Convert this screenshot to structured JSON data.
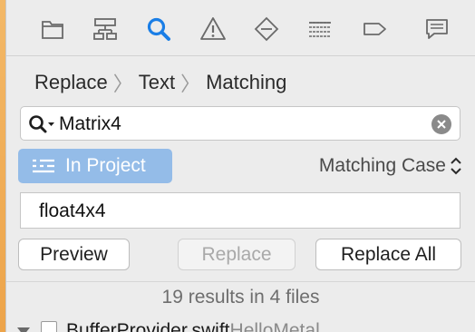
{
  "navigator": {
    "tabs": [
      {
        "name": "project-navigator",
        "icon": "folder-icon"
      },
      {
        "name": "symbol-navigator",
        "icon": "hierarchy-icon"
      },
      {
        "name": "find-navigator",
        "icon": "magnifier-icon",
        "selected": true
      },
      {
        "name": "issue-navigator",
        "icon": "warning-icon"
      },
      {
        "name": "test-navigator",
        "icon": "diamond-icon"
      },
      {
        "name": "debug-navigator",
        "icon": "list-icon"
      },
      {
        "name": "breakpoint-navigator",
        "icon": "tag-icon"
      },
      {
        "name": "report-navigator",
        "icon": "speech-bubble-icon"
      }
    ],
    "accent_color": "#1a7ee6",
    "icon_color": "#6a6a6a"
  },
  "find": {
    "breadcrumb": [
      "Replace",
      "Text",
      "Matching"
    ],
    "query": "Matrix4",
    "scope_label": "In Project",
    "matching_label": "Matching Case",
    "replacement": "float4x4",
    "buttons": {
      "preview": "Preview",
      "replace": "Replace",
      "replace_all": "Replace All"
    }
  },
  "results": {
    "summary": "19 results in 4 files",
    "first_row": {
      "file": "BufferProvider.swift",
      "project": "HelloMetal"
    }
  }
}
